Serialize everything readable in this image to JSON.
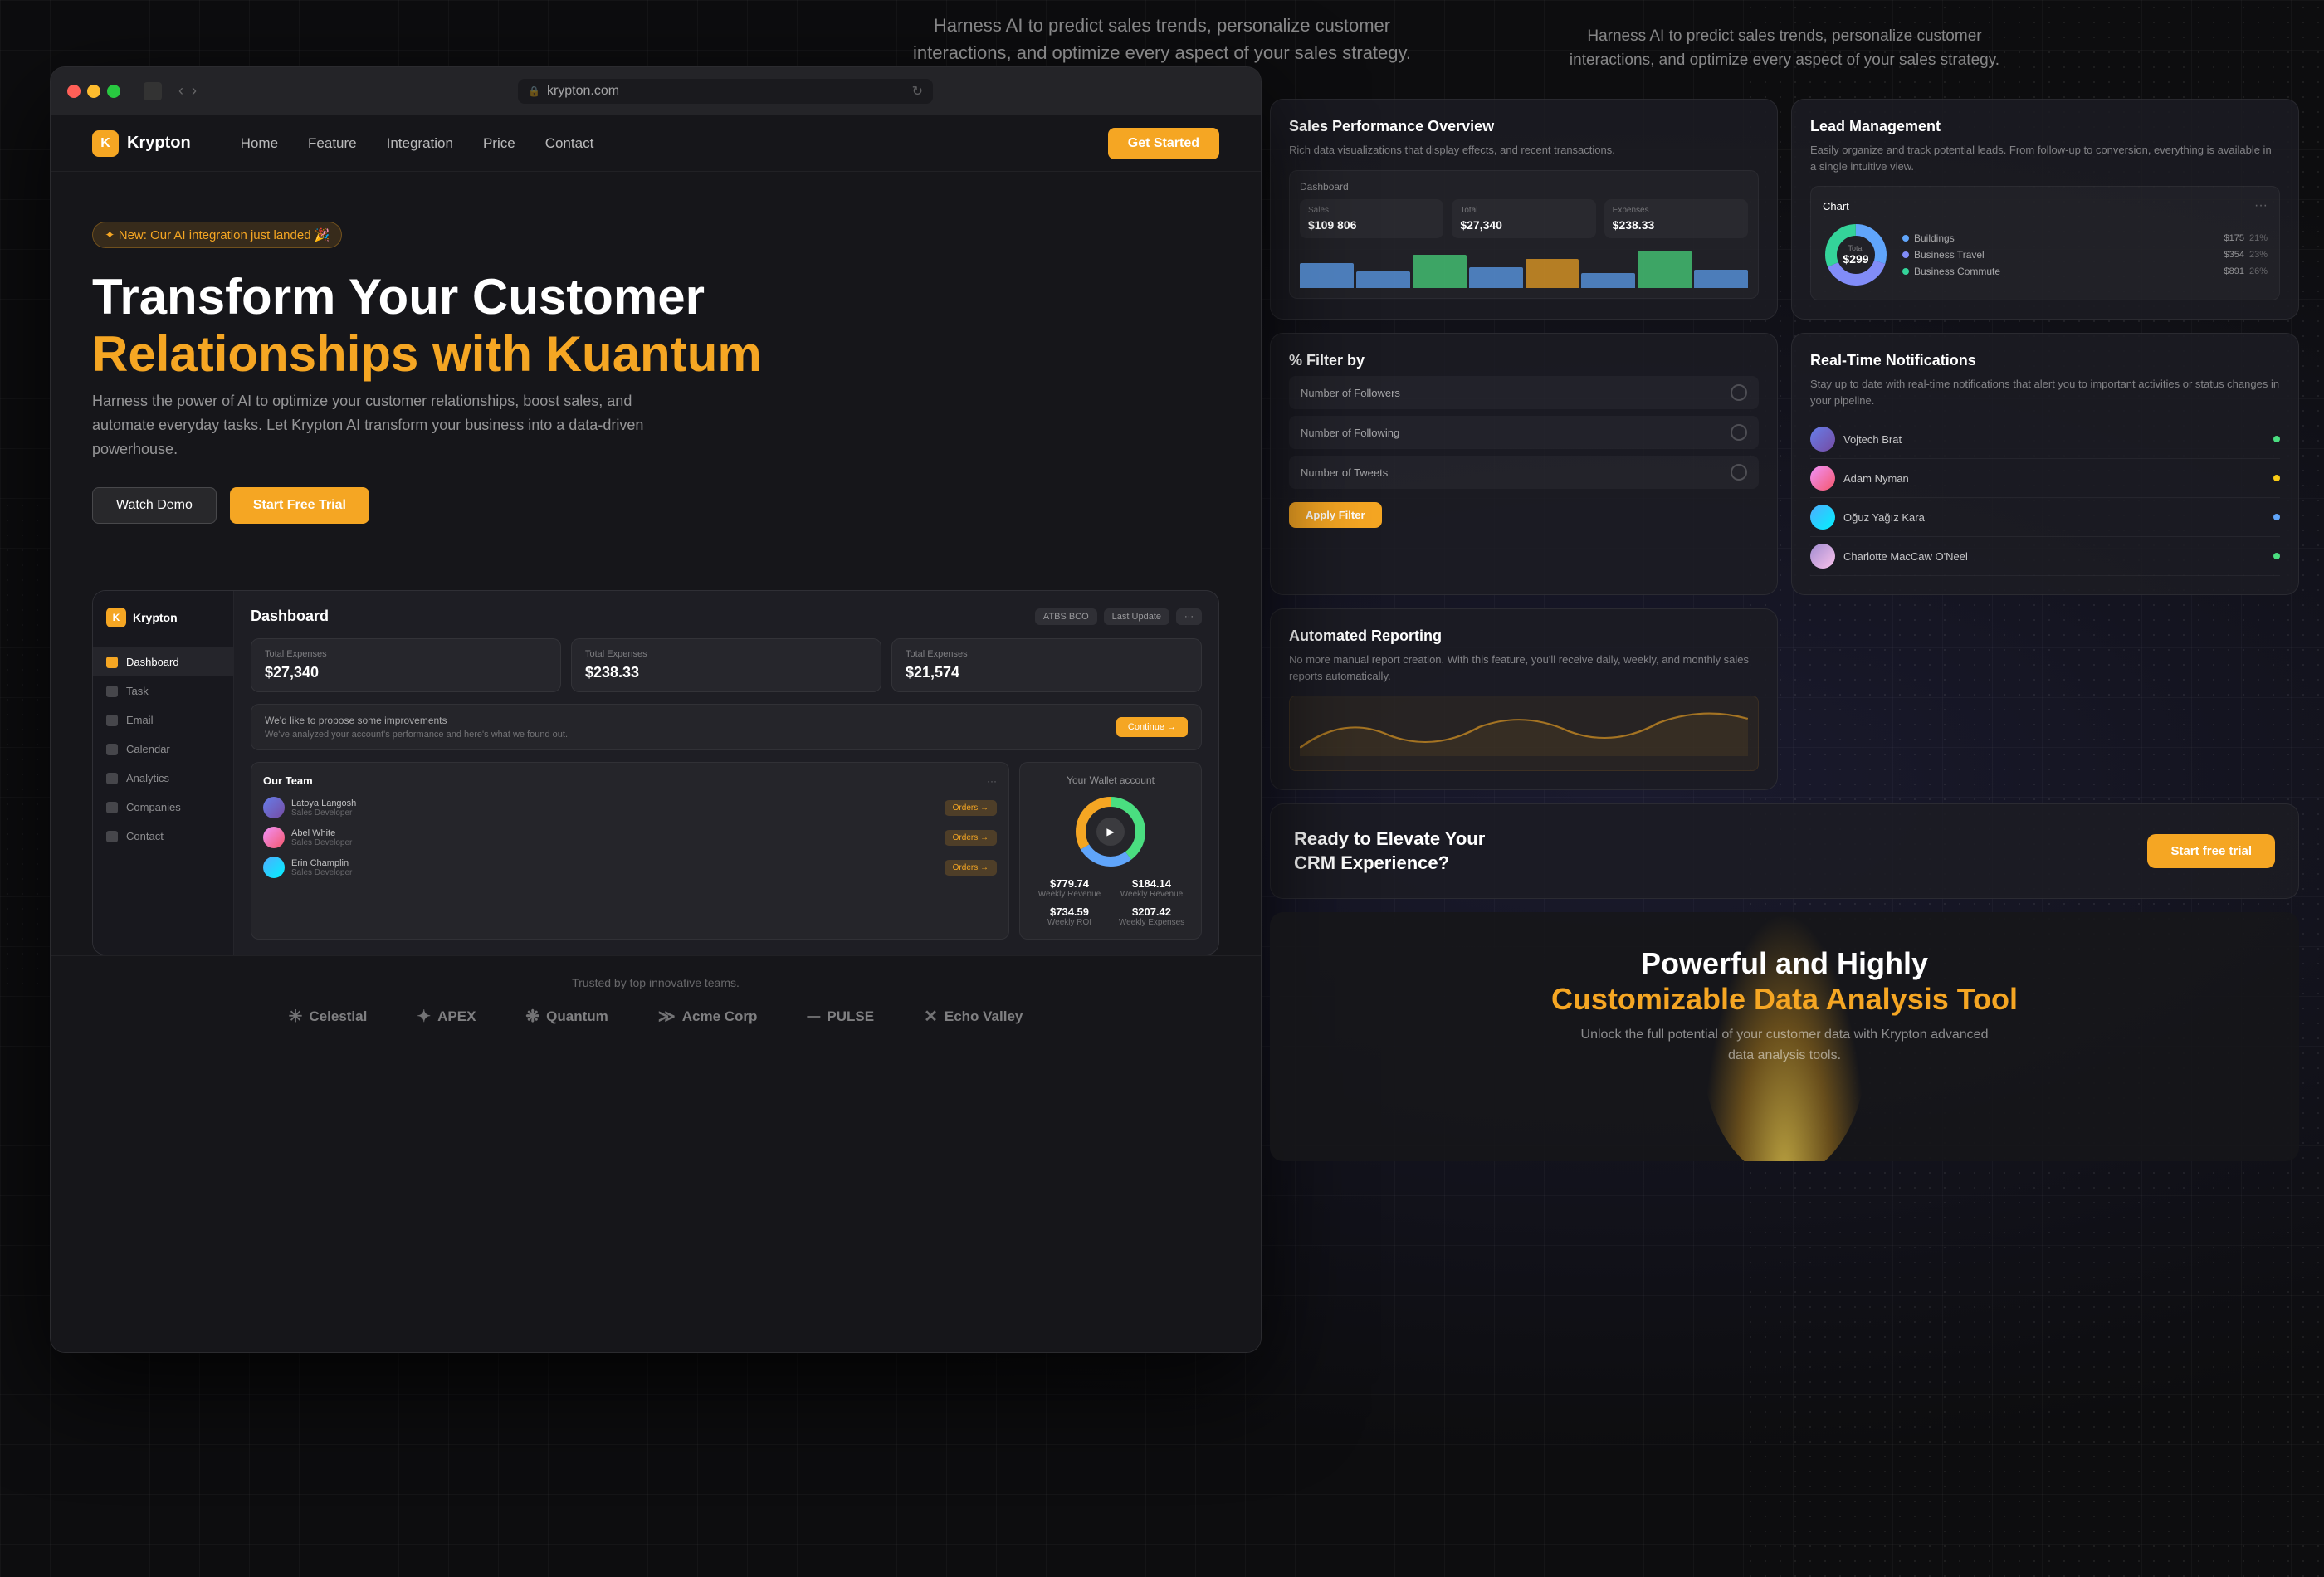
{
  "browser": {
    "url": "krypton.com",
    "address_display": "krypton.com"
  },
  "top_tagline": {
    "line1": "Harness AI to predict sales trends, personalize customer",
    "line2": "interactions, and optimize every aspect of your sales strategy."
  },
  "site": {
    "logo_letter": "K",
    "logo_name": "Krypton",
    "nav": {
      "links": [
        "Home",
        "Feature",
        "Integration",
        "Price",
        "Contact"
      ],
      "cta": "Get Started"
    },
    "badge": "✦ New: Our AI integration just landed 🎉",
    "hero": {
      "title_line1": "Transform Your Customer",
      "title_line2": "Relationships with Kuantum",
      "subtitle": "Harness the power of AI to optimize your customer relationships, boost sales, and automate everyday tasks. Let Krypton AI transform your business into a data-driven powerhouse.",
      "btn_watch": "Watch Demo",
      "btn_start": "Start Free Trial"
    },
    "dashboard": {
      "title": "Dashboard",
      "pill1": "ATBS BCO",
      "pill2": "Last Update",
      "sidebar_items": [
        "Dashboard",
        "Task",
        "Email",
        "Calendar",
        "Analytics",
        "Companies",
        "Contact"
      ],
      "stats": [
        {
          "label": "Total Expenses",
          "value": "$27,340"
        },
        {
          "label": "Total Expenses",
          "value": "$238.33"
        },
        {
          "label": "Total Expenses",
          "value": "$21,574"
        }
      ],
      "suggestion_title": "We'd like to propose some improvements",
      "suggestion_sub": "We've analyzed your account's performance and here's what we found out.",
      "btn_continue": "Continue →",
      "team": {
        "title": "Our Team",
        "members": [
          {
            "name": "Latoya Langosh",
            "role": "Sales Developer"
          },
          {
            "name": "Abel White",
            "role": "Sales Developer"
          },
          {
            "name": "Erin Champlin",
            "role": "Sales Developer"
          }
        ]
      },
      "wallet": {
        "title": "Your Wallet account",
        "stats": [
          {
            "label": "Weekly Revenue",
            "value": "$779.74"
          },
          {
            "label": "Weekly Revenue",
            "value": "$184.14"
          },
          {
            "label": "Weekly RO1",
            "value": "$734.59"
          },
          {
            "label": "Weekly Expenses",
            "value": "$207.42"
          }
        ]
      }
    },
    "trusted": {
      "text": "Trusted by top innovative teams.",
      "brands": [
        "Celestial",
        "APEX",
        "Quantum",
        "Acme Corp",
        "PULSE",
        "Echo Valley"
      ]
    }
  },
  "features": {
    "sales_perf": {
      "title": "Sales Performance Overview",
      "desc": "Rich data visualizations that display effects, and recent transactions."
    },
    "lead_mgmt": {
      "title": "Lead Management",
      "desc": "Easily organize and track potential leads. From follow-up to conversion, everything is available in a single intuitive view.",
      "chart_label": "Total",
      "chart_value": "$299",
      "legend": [
        {
          "label": "Buildings",
          "value": "$175",
          "pct": "21%",
          "color": "#60a5fa"
        },
        {
          "label": "Business Travel",
          "value": "$354",
          "pct": "23%",
          "color": "#818cf8"
        },
        {
          "label": "Business Commute",
          "value": "$891",
          "pct": "26%",
          "color": "#34d399"
        }
      ]
    },
    "filter": {
      "title": "% Filter by",
      "items": [
        "Number of Followers",
        "Number of Following",
        "Number of Tweets"
      ],
      "submit_btn": "Apply Filter"
    },
    "notifications": {
      "title": "Real-Time Notifications",
      "desc": "Stay up to date with real-time notifications that alert you to important activities or status changes in your pipeline.",
      "people": [
        {
          "name": "Vojtech Brat",
          "status": "green"
        },
        {
          "name": "Adam Nyman",
          "status": "yellow"
        },
        {
          "name": "Oğuz Yağız Kara",
          "status": "blue"
        },
        {
          "name": "Charlotte MacCaw O'Neel",
          "status": "green"
        }
      ]
    },
    "auto_reporting": {
      "title": "Automated Reporting",
      "desc": "No more manual report creation. With this feature, you'll receive daily, weekly, and monthly sales reports automatically."
    },
    "cta": {
      "text_line1": "Ready to Elevate Your",
      "text_line2": "CRM Experience?",
      "btn": "Start free trial"
    }
  },
  "bottom": {
    "title_line1": "Powerful and Highly",
    "title_line2": "Customizable Data Analysis Tool",
    "subtitle": "Unlock the full potential of your customer data with Krypton advanced data analysis tools."
  }
}
